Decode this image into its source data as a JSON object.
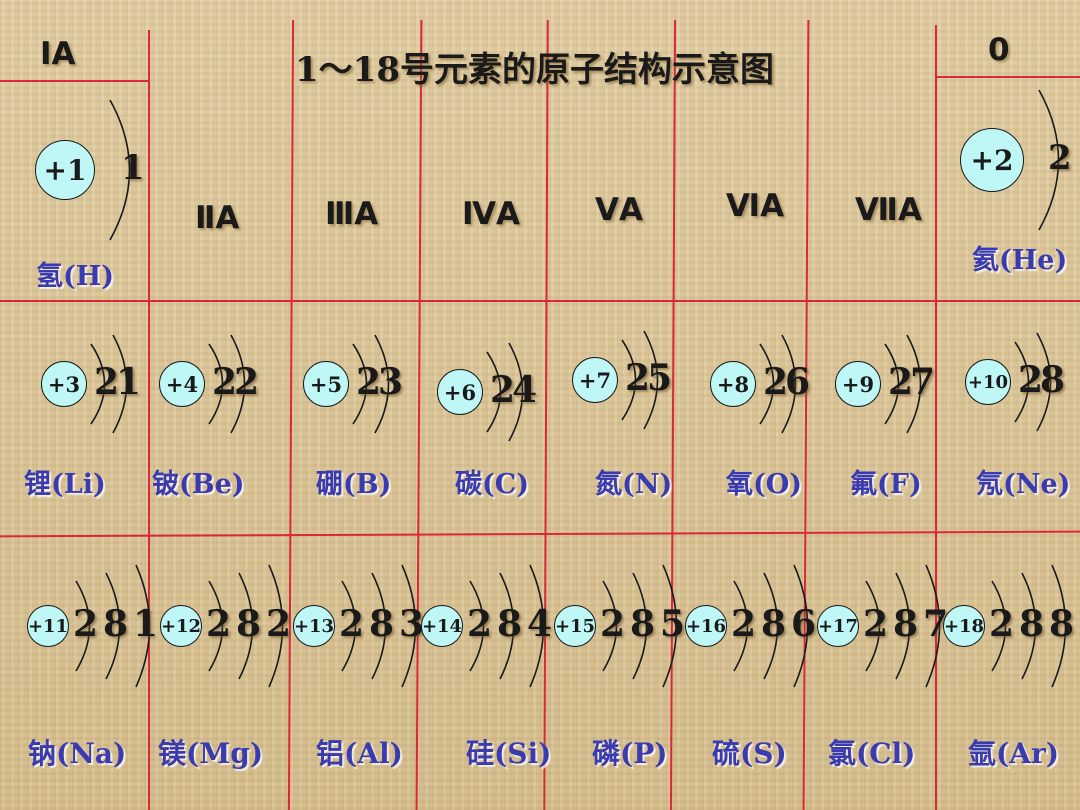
{
  "title": "1～18号元素的原子结构示意图",
  "groups": {
    "g1": "ⅠA",
    "g2": "ⅡA",
    "g3": "ⅢA",
    "g4": "ⅣA",
    "g5": "ⅤA",
    "g6": "ⅥA",
    "g7": "ⅦA",
    "g0": "0"
  },
  "colors": {
    "grid_line": "#d8283a",
    "nucleus_fill": "#bff7f7",
    "element_name": "#3b3bb0",
    "text": "#1a1a1a"
  },
  "row1": [
    {
      "charge": "+1",
      "shells": [
        "1"
      ],
      "name": "氢(H)"
    },
    {
      "charge": "+2",
      "shells": [
        "2"
      ],
      "name": "氦(He)"
    }
  ],
  "row2": [
    {
      "charge": "+3",
      "shells": [
        "2",
        "1"
      ],
      "name": "锂(Li)"
    },
    {
      "charge": "+4",
      "shells": [
        "2",
        "2"
      ],
      "name": "铍(Be)"
    },
    {
      "charge": "+5",
      "shells": [
        "2",
        "3"
      ],
      "name": "硼(B)"
    },
    {
      "charge": "+6",
      "shells": [
        "2",
        "4"
      ],
      "name": "碳(C)"
    },
    {
      "charge": "+7",
      "shells": [
        "2",
        "5"
      ],
      "name": "氮(N)"
    },
    {
      "charge": "+8",
      "shells": [
        "2",
        "6"
      ],
      "name": "氧(O)"
    },
    {
      "charge": "+9",
      "shells": [
        "2",
        "7"
      ],
      "name": "氟(F)"
    },
    {
      "charge": "+10",
      "shells": [
        "2",
        "8"
      ],
      "name": "氖(Ne)"
    }
  ],
  "row3": [
    {
      "charge": "+11",
      "shells": [
        "2",
        "8",
        "1"
      ],
      "name": "钠(Na)"
    },
    {
      "charge": "+12",
      "shells": [
        "2",
        "8",
        "2"
      ],
      "name": "镁(Mg)"
    },
    {
      "charge": "+13",
      "shells": [
        "2",
        "8",
        "3"
      ],
      "name": "铝(Al)"
    },
    {
      "charge": "+14",
      "shells": [
        "2",
        "8",
        "4"
      ],
      "name": "硅(Si)"
    },
    {
      "charge": "+15",
      "shells": [
        "2",
        "8",
        "5"
      ],
      "name": "磷(P)"
    },
    {
      "charge": "+16",
      "shells": [
        "2",
        "8",
        "6"
      ],
      "name": "硫(S)"
    },
    {
      "charge": "+17",
      "shells": [
        "2",
        "8",
        "7"
      ],
      "name": "氯(Cl)"
    },
    {
      "charge": "+18",
      "shells": [
        "2",
        "8",
        "8"
      ],
      "name": "氩(Ar)"
    }
  ]
}
